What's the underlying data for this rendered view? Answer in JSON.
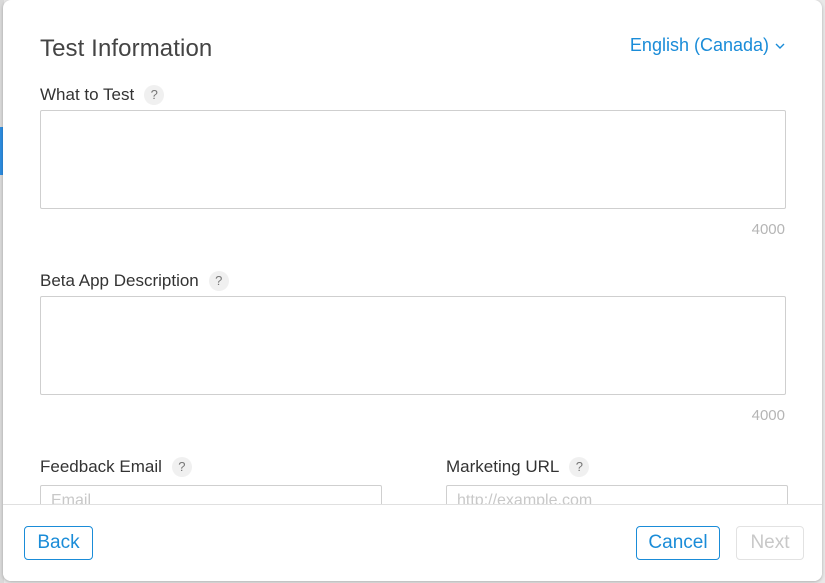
{
  "modal": {
    "title": "Test Information",
    "locale": "English (Canada)"
  },
  "fields": {
    "what_to_test": {
      "label": "What to Test",
      "help": "?",
      "value": "",
      "counter": "4000"
    },
    "beta_app_description": {
      "label": "Beta App Description",
      "help": "?",
      "value": "",
      "counter": "4000"
    },
    "feedback_email": {
      "label": "Feedback Email",
      "help": "?",
      "placeholder": "Email"
    },
    "marketing_url": {
      "label": "Marketing URL",
      "help": "?",
      "placeholder": "http://example.com"
    }
  },
  "footer": {
    "back_label": "Back",
    "cancel_label": "Cancel",
    "next_label": "Next"
  },
  "colors": {
    "accent": "#1a8cd8",
    "disabled": "#c8c8c8"
  }
}
